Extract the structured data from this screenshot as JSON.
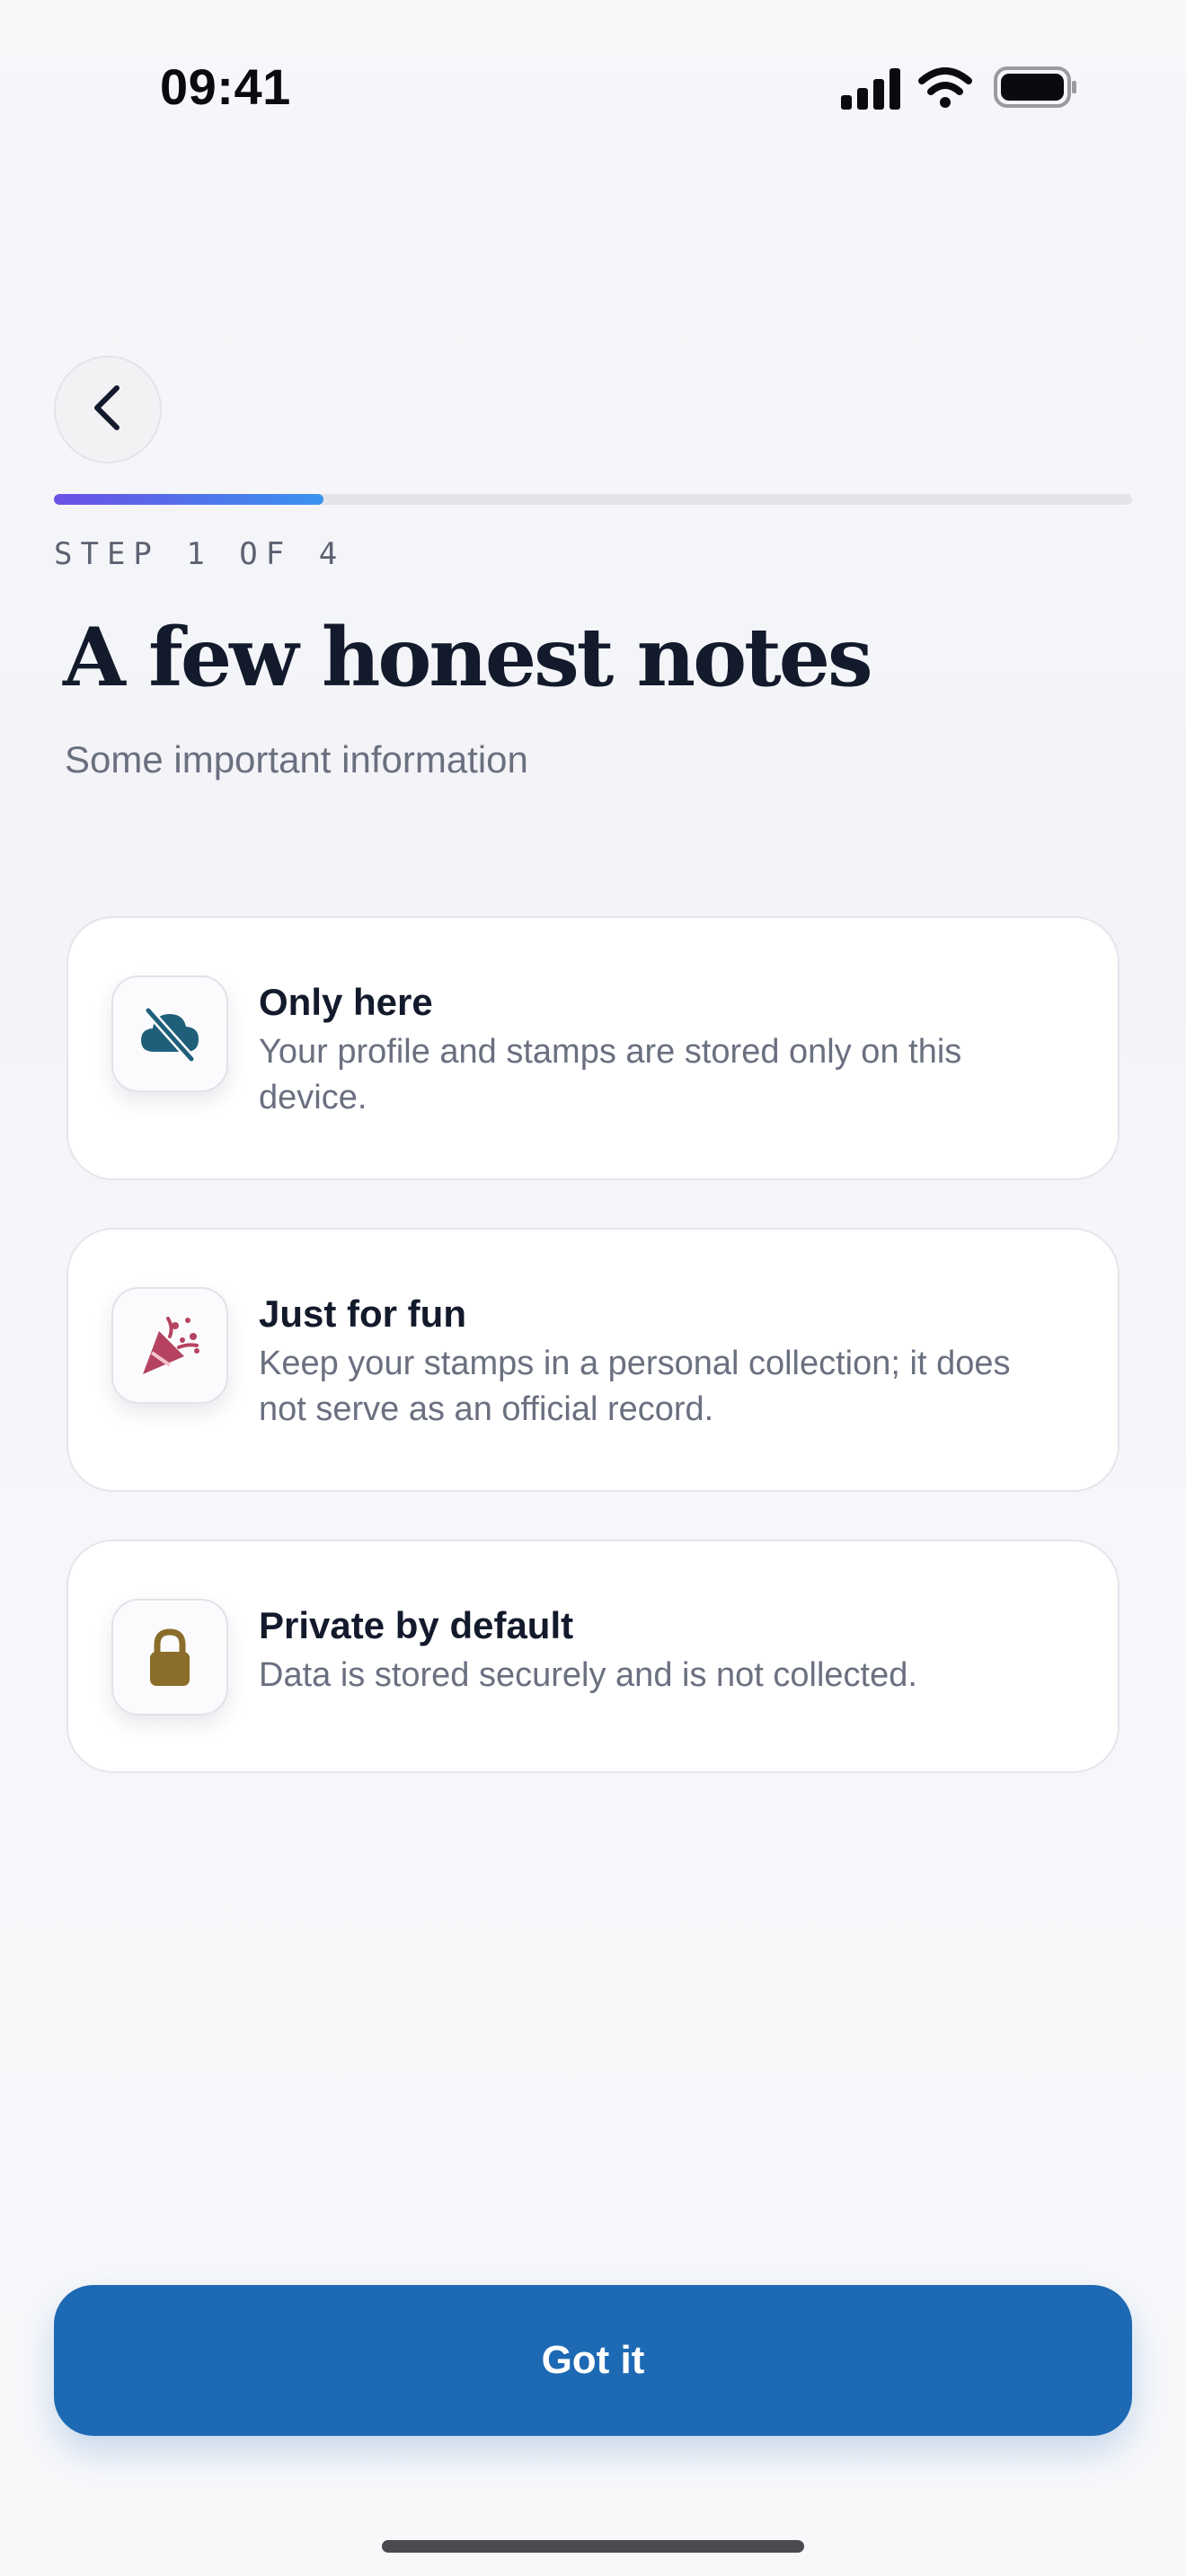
{
  "status_bar": {
    "time": "09:41"
  },
  "progress": {
    "fraction": 0.25,
    "step_label": "STEP 1 OF 4"
  },
  "header": {
    "title": "A few honest notes",
    "subtitle": "Some important information"
  },
  "cards": [
    {
      "icon": "cloud-off-icon",
      "icon_color": "#1f5f7a",
      "title": "Only here",
      "description": "Your profile and stamps are stored only on this device."
    },
    {
      "icon": "party-popper-icon",
      "icon_color": "#b5435f",
      "title": "Just for fun",
      "description": "Keep your stamps in a personal collection; it does not serve as an official record."
    },
    {
      "icon": "lock-icon",
      "icon_color": "#8a6d2a",
      "title": "Private by default",
      "description": "Data is stored securely and is not collected."
    }
  ],
  "primary_action": {
    "label": "Got it"
  },
  "colors": {
    "accent": "#1d69b4",
    "progress_start": "#6b4fe6",
    "progress_end": "#3a93ef"
  }
}
